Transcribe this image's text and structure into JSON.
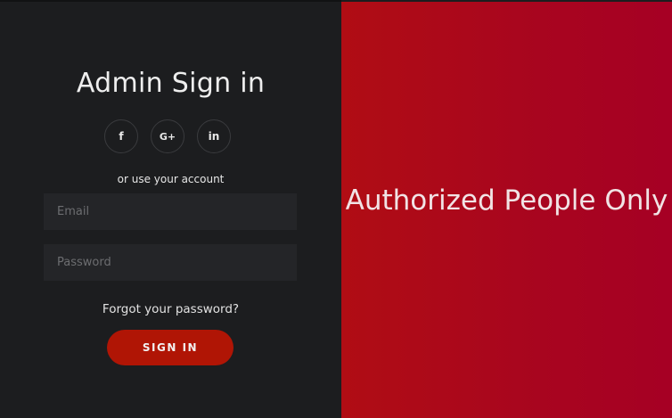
{
  "left": {
    "title": "Admin Sign in",
    "social_buttons": [
      {
        "icon": "facebook-icon",
        "glyph": "f"
      },
      {
        "icon": "google-plus-icon",
        "glyph": "G+"
      },
      {
        "icon": "linkedin-icon",
        "glyph": "in"
      }
    ],
    "hint": "or use your account",
    "email_placeholder": "Email",
    "password_placeholder": "Password",
    "forgot": "Forgot your password?",
    "signin": "SIGN IN"
  },
  "right": {
    "message": "Authorized People Only"
  },
  "colors": {
    "background": "#1c1d1f",
    "accent": "#b01505",
    "panel": "#a8051f"
  }
}
